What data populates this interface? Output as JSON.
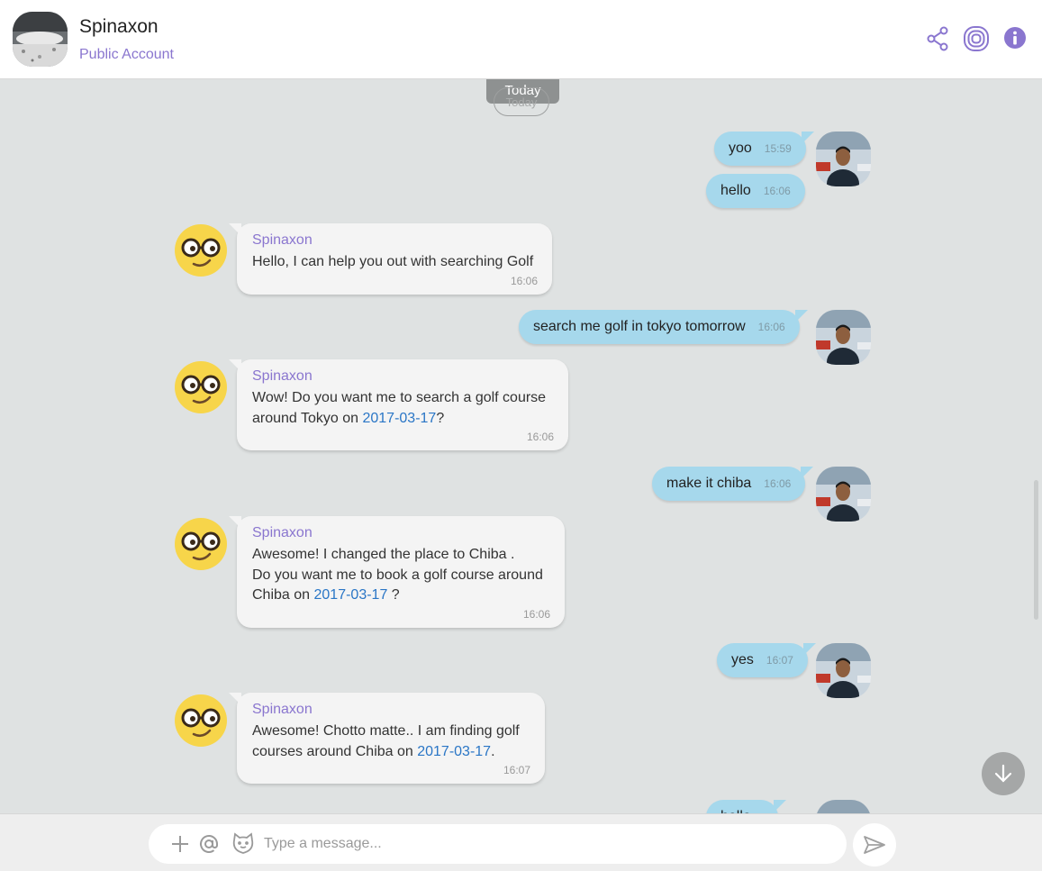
{
  "header": {
    "title": "Spinaxon",
    "subtitle": "Public Account",
    "icons": [
      "share-icon",
      "concentric-squares-icon",
      "info-icon"
    ]
  },
  "colors": {
    "accent": "#8a76cf",
    "outgoing_bubble": "#a6d8ec",
    "incoming_bubble": "#f4f4f4",
    "chat_background": "#dfe2e2",
    "date_link": "#2a76c6"
  },
  "day_separator": {
    "label": "Today",
    "ghost_label": "Today"
  },
  "messages": [
    {
      "dir": "out",
      "text": "yoo",
      "time": "15:59"
    },
    {
      "dir": "out",
      "text": "hello",
      "time": "16:06"
    },
    {
      "dir": "in",
      "sender": "Spinaxon",
      "lines": [
        "Hello, I can help you out with searching Golf"
      ],
      "time": "16:06"
    },
    {
      "dir": "out",
      "text": "search me golf in tokyo tomorrow",
      "time": "16:06"
    },
    {
      "dir": "in",
      "sender": "Spinaxon",
      "lines": [
        "Wow! Do you want me to search a  golf course",
        "around Tokyo on ",
        "2017-03-17",
        "?"
      ],
      "time": "16:06"
    },
    {
      "dir": "out",
      "text": "make it chiba",
      "time": "16:06"
    },
    {
      "dir": "in",
      "sender": "Spinaxon",
      "lines": [
        "Awesome! I changed the place to Chiba .",
        "Do you want me to book a golf course around",
        "Chiba on ",
        "2017-03-17",
        " ?"
      ],
      "time": "16:06"
    },
    {
      "dir": "out",
      "text": "yes",
      "time": "16:07"
    },
    {
      "dir": "in",
      "sender": "Spinaxon",
      "lines": [
        "Awesome! Chotto matte.. I am finding  golf",
        "courses around Chiba on ",
        "2017-03-17",
        "."
      ],
      "time": "16:07"
    },
    {
      "dir": "out",
      "text": "hello",
      "time": ""
    }
  ],
  "composer": {
    "placeholder": "Type a message...",
    "icons": [
      "plus-icon",
      "at-icon",
      "cat-emoji-icon",
      "send-icon"
    ]
  },
  "scroll_down_icon": "arrow-down-icon"
}
